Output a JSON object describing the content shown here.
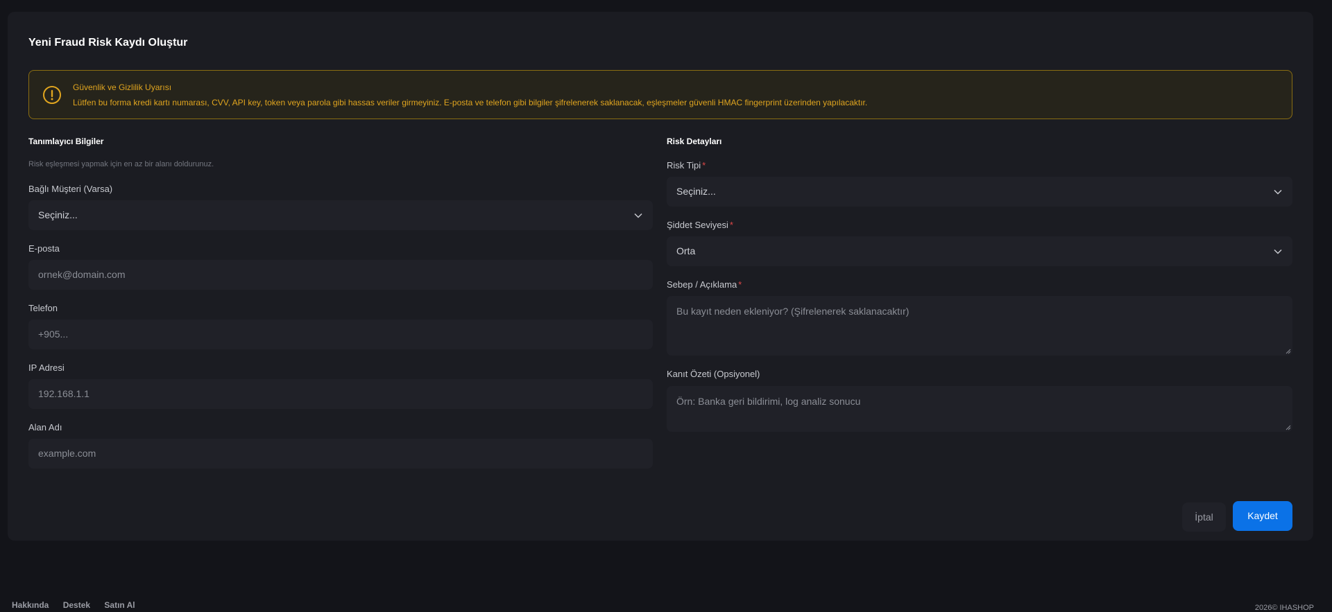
{
  "form": {
    "title": "Yeni Fraud Risk Kaydı Oluştur"
  },
  "alert": {
    "icon": "warning-circle-icon",
    "title": "Güvenlik ve Gizlilik Uyarısı",
    "text": "Lütfen bu forma kredi kartı numarası, CVV, API key, token veya parola gibi hassas veriler girmeyiniz. E-posta ve telefon gibi bilgiler şifrelenerek saklanacak, eşleşmeler güvenli HMAC fingerprint üzerinden yapılacaktır.",
    "color": "#e0a51f"
  },
  "identifiers": {
    "title": "Tanımlayıcı Bilgiler",
    "hint": "Risk eşleşmesi yapmak için en az bir alanı doldurunuz.",
    "customer": {
      "label": "Bağlı Müşteri (Varsa)",
      "value": "Seçiniz..."
    },
    "email": {
      "label": "E-posta",
      "placeholder": "ornek@domain.com"
    },
    "phone": {
      "label": "Telefon",
      "placeholder": "+905..."
    },
    "ip": {
      "label": "IP Adresi",
      "placeholder": "192.168.1.1"
    },
    "domain": {
      "label": "Alan Adı",
      "placeholder": "example.com"
    }
  },
  "risk": {
    "title": "Risk Detayları",
    "type": {
      "label": "Risk Tipi",
      "required": "*",
      "value": "Seçiniz..."
    },
    "severity": {
      "label": "Şiddet Seviyesi",
      "required": "*",
      "value": "Orta"
    },
    "reason": {
      "label": "Sebep / Açıklama",
      "required": "*",
      "placeholder": "Bu kayıt neden ekleniyor? (Şifrelenerek saklanacaktır)"
    },
    "evidence": {
      "label": "Kanıt Özeti (Opsiyonel)",
      "placeholder": "Örn: Banka geri bildirimi, log analiz sonucu"
    }
  },
  "actions": {
    "cancel": "İptal",
    "save": "Kaydet",
    "primary_color": "#0b72e7"
  },
  "footer": {
    "links": [
      "Hakkında",
      "Destek",
      "Satın Al"
    ],
    "copyright": "2026© IHASHOP"
  }
}
